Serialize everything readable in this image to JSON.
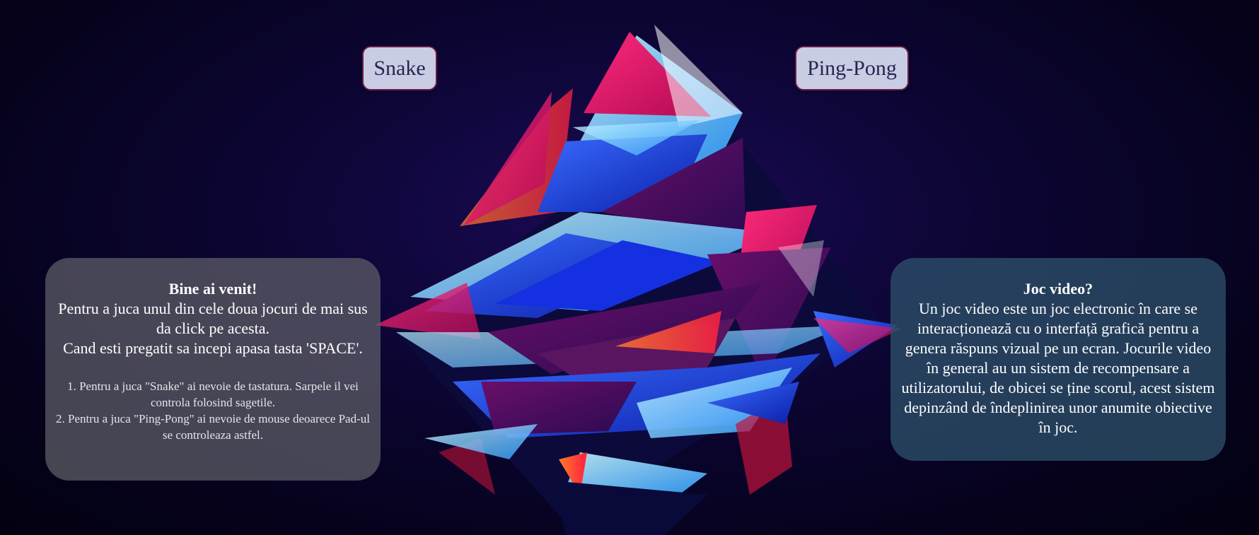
{
  "nav": {
    "snake_label": "Snake",
    "pong_label": "Ping-Pong"
  },
  "welcome": {
    "title": "Bine ai venit!",
    "line1": "Pentru a juca unul din cele doua jocuri de mai sus da click pe acesta.",
    "line2": "Cand esti pregatit sa incepi apasa tasta 'SPACE'.",
    "instruction1": "1. Pentru a juca \"Snake\" ai nevoie de tastatura. Sarpele il vei controla folosind sagetile.",
    "instruction2": "2. Pentru a juca \"Ping-Pong\" ai nevoie de mouse deoarece Pad-ul se controleaza astfel."
  },
  "info": {
    "title": "Joc video?",
    "text": "Un joc video este un joc electronic în care se interacționează cu o interfață grafică pentru a genera răspuns vizual pe un ecran. Jocurile video în general au un sistem de recompensare a utilizatorului, de obicei se ține scorul, acest sistem depinzând de îndeplinirea unor anumite obiective în joc."
  },
  "colors": {
    "button_bg": "#c9cde3",
    "button_border": "#6a1d4a",
    "left_panel_bg": "rgba(95,95,105,0.72)",
    "right_panel_bg": "rgba(45,80,105,0.78)"
  }
}
